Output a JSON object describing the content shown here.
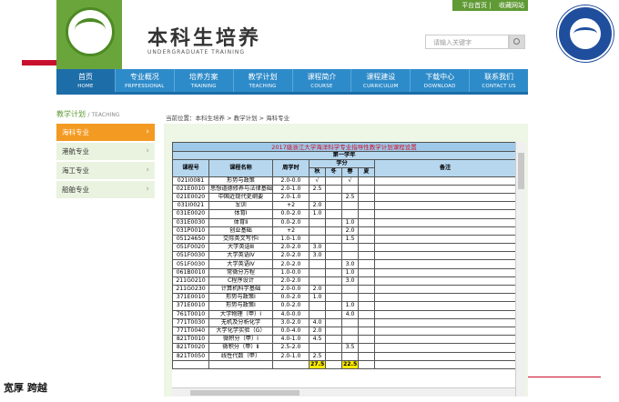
{
  "slide": {
    "motto": "宽厚 跨越"
  },
  "site": {
    "toplinks": [
      "平台首页",
      "收藏网站"
    ],
    "title_cn": "本科生培养",
    "title_en": "UNDERGRADUATE TRAINING",
    "search_placeholder": "请输入关键字",
    "nav": [
      {
        "cn": "首页",
        "en": "HOME"
      },
      {
        "cn": "专业概况",
        "en": "PRPFESSIONAL"
      },
      {
        "cn": "培养方案",
        "en": "TRAINING"
      },
      {
        "cn": "教学计划",
        "en": "TEACHING"
      },
      {
        "cn": "课程简介",
        "en": "COURSE"
      },
      {
        "cn": "课程建设",
        "en": "CURRICULUM"
      },
      {
        "cn": "下载中心",
        "en": "DOWNLOAD"
      },
      {
        "cn": "联系我们",
        "en": "CONTACT US"
      }
    ],
    "sidebar": {
      "title": "教学计划",
      "title_en": "/ TEACHING",
      "items": [
        "海科专业",
        "港航专业",
        "海工专业",
        "船舶专业"
      ]
    },
    "breadcrumb": "当前位置：本科生培养 > 教学计划 > 海科专业"
  },
  "table": {
    "title": "2017級浙江大学海洋科学专业指导性教学计划课程设置",
    "year": "第一学年",
    "headers": {
      "code": "课程号",
      "name": "课程名称",
      "hours": "周学时",
      "credit": "学分",
      "autumn": "秋",
      "winter": "冬",
      "spring": "春",
      "summer": "夏",
      "note": "备注"
    },
    "rows": [
      [
        "021I0081",
        "形势与政策",
        "2.0-0.0",
        "√",
        "",
        "√",
        ""
      ],
      [
        "021E0010",
        "思想道德修养与法律基础",
        "2.0-1.0",
        "2.5",
        "",
        "",
        ""
      ],
      [
        "021E0020",
        "中国近现代史纲要",
        "2.0-1.0",
        "",
        "",
        "2.5",
        ""
      ],
      [
        "031I0021",
        "军训",
        "+2",
        "2.0",
        "",
        "",
        ""
      ],
      [
        "031E0020",
        "体育Ⅰ",
        "0.0-2.0",
        "1.0",
        "",
        "",
        ""
      ],
      [
        "031E0030",
        "体育Ⅱ",
        "0.0-2.0",
        "",
        "",
        "1.0",
        ""
      ],
      [
        "031P0010",
        "创业基础",
        "+2",
        "",
        "",
        "2.0",
        ""
      ],
      [
        "05124650",
        "交际英文写作Ⅰ",
        "1.0-1.0",
        "",
        "",
        "1.5",
        ""
      ],
      [
        "051F0020",
        "大学英语Ⅲ",
        "2.0-2.0",
        "3.0",
        "",
        "",
        ""
      ],
      [
        "051F0030",
        "大学英语Ⅳ",
        "2.0-2.0",
        "3.0",
        "",
        "",
        ""
      ],
      [
        "051F0030",
        "大学英语Ⅳ",
        "2.0-2.0",
        "",
        "",
        "3.0",
        ""
      ],
      [
        "061B0010",
        "常微分方程",
        "1.0-0.0",
        "",
        "",
        "1.0",
        ""
      ],
      [
        "211G0210",
        "C程序设计",
        "2.0-2.0",
        "",
        "",
        "3.0",
        ""
      ],
      [
        "211G0230",
        "计算机科学基础",
        "2.0-0.0",
        "2.0",
        "",
        "",
        ""
      ],
      [
        "371E0010",
        "形势与政策Ⅰ",
        "0.0-2.0",
        "1.0",
        "",
        "",
        ""
      ],
      [
        "371E0010",
        "形势与政策Ⅰ",
        "0.0-2.0",
        "",
        "",
        "1.0",
        ""
      ],
      [
        "761T0010",
        "大学物理（甲）Ⅰ",
        "4.0-0.0",
        "",
        "",
        "4.0",
        ""
      ],
      [
        "771T0030",
        "无机及分析化学",
        "3.0-2.0",
        "4.0",
        "",
        "",
        ""
      ],
      [
        "771T0040",
        "大学化学实验（G）",
        "0.0-4.0",
        "2.0",
        "",
        "",
        ""
      ],
      [
        "821T0010",
        "微积分（甲）Ⅰ",
        "4.0-1.0",
        "4.5",
        "",
        "",
        ""
      ],
      [
        "821T0020",
        "微积分（甲）Ⅱ",
        "2.5-2.0",
        "",
        "",
        "3.5",
        ""
      ],
      [
        "821T0050",
        "线性代数（甲）",
        "2.0-1.0",
        "2.5",
        "",
        "",
        ""
      ]
    ],
    "totals": {
      "autumn": "27.5",
      "spring": "22.5"
    }
  }
}
